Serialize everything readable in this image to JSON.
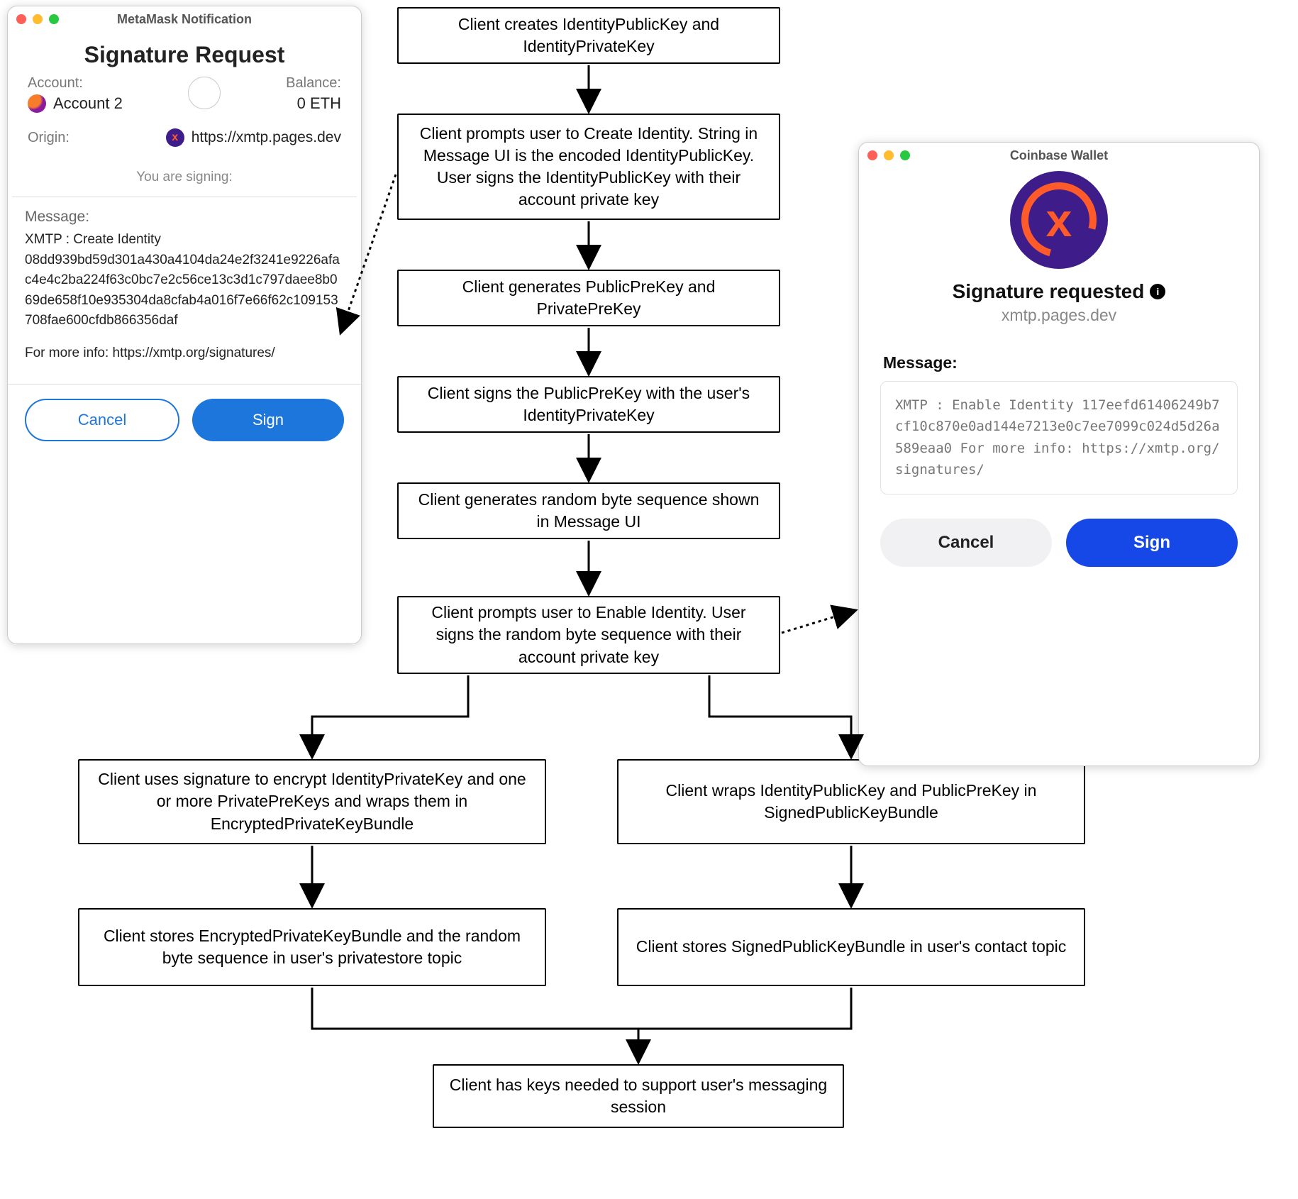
{
  "flow": {
    "step1": "Client creates IdentityPublicKey and IdentityPrivateKey",
    "step2": "Client prompts user to Create Identity. String in Message UI is the encoded IdentityPublicKey. User signs the IdentityPublicKey with their account private key",
    "step3": "Client generates PublicPreKey and PrivatePreKey",
    "step4": "Client signs the PublicPreKey with the user's IdentityPrivateKey",
    "step5": "Client generates random byte sequence shown in Message UI",
    "step6": "Client prompts user to Enable Identity. User signs the random byte sequence with their account private key",
    "step7a": "Client uses signature to encrypt IdentityPrivateKey and one or more PrivatePreKeys and wraps them in EncryptedPrivateKeyBundle",
    "step7b": "Client wraps IdentityPublicKey and PublicPreKey in SignedPublicKeyBundle",
    "step8a": "Client stores EncryptedPrivateKeyBundle and the random byte sequence in user's privatestore topic",
    "step8b": "Client stores SignedPublicKeyBundle in user's contact topic",
    "step9": "Client has keys needed to support user's messaging session"
  },
  "metamask": {
    "window_title": "MetaMask Notification",
    "heading": "Signature Request",
    "account_label": "Account:",
    "account_value": "Account 2",
    "balance_label": "Balance:",
    "balance_value": "0 ETH",
    "origin_label": "Origin:",
    "origin_value": "https://xmtp.pages.dev",
    "signing_label": "You are signing:",
    "message_label": "Message:",
    "message_line1": "XMTP : Create Identity",
    "message_hex": "08dd939bd59d301a430a4104da24e2f3241e9226afac4e4c2ba224f63c0bc7e2c56ce13c3d1c797daee8b069de658f10e935304da8cfab4a016f7e66f62c109153708fae600cfdb866356daf",
    "message_footer": "For more info: https://xmtp.org/signatures/",
    "cancel": "Cancel",
    "sign": "Sign"
  },
  "coinbase": {
    "window_title": "Coinbase Wallet",
    "heading": "Signature requested",
    "subheading": "xmtp.pages.dev",
    "message_label": "Message:",
    "message_body": "XMTP : Enable Identity 117eefd61406249b7cf10c870e0ad144e7213e0c7ee7099c024d5d26a589eaa0 For more info: https://xmtp.org/signatures/",
    "cancel": "Cancel",
    "sign": "Sign"
  }
}
